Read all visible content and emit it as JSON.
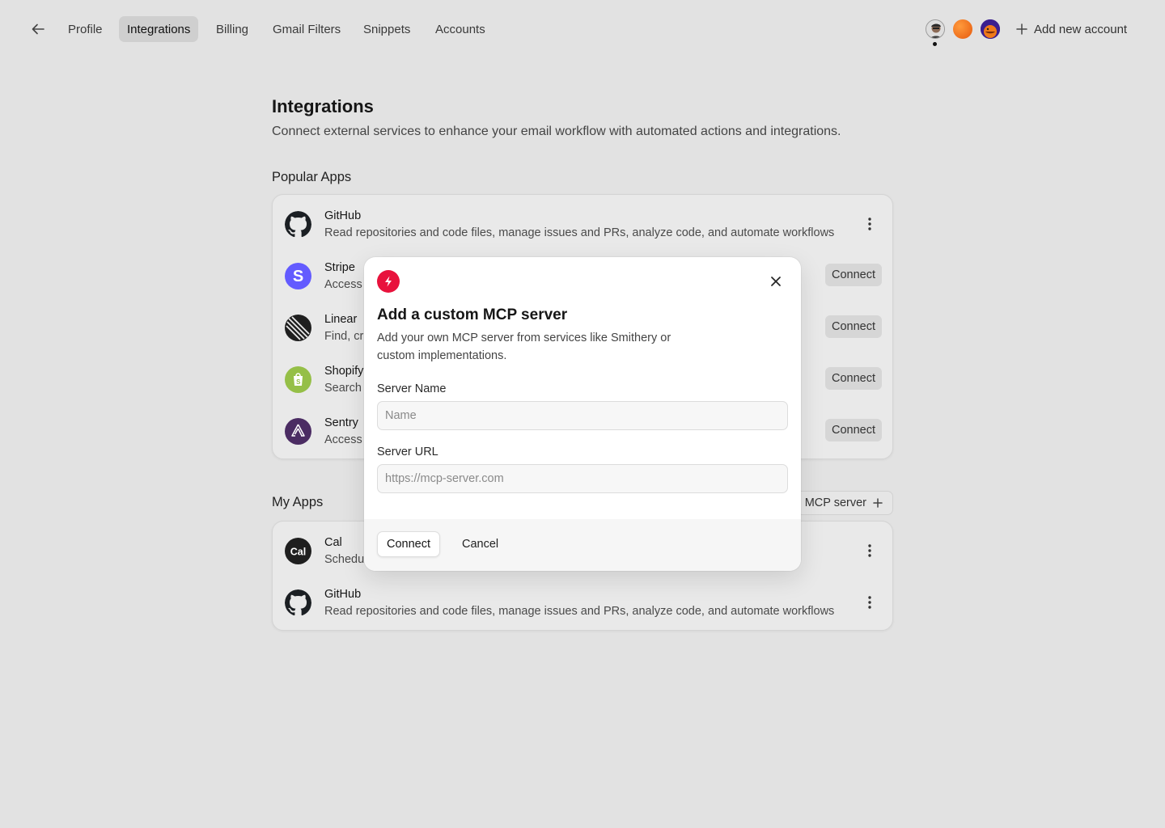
{
  "nav": {
    "back_icon": "arrow-left-icon",
    "tabs": [
      {
        "label": "Profile",
        "active": false
      },
      {
        "label": "Integrations",
        "active": true
      },
      {
        "label": "Billing",
        "active": false
      },
      {
        "label": "Gmail Filters",
        "active": false
      },
      {
        "label": "Snippets",
        "active": false
      },
      {
        "label": "Accounts",
        "active": false
      }
    ],
    "add_account_label": "Add new account"
  },
  "page": {
    "title": "Integrations",
    "subtitle": "Connect external services to enhance your email workflow with automated actions and integrations."
  },
  "popular": {
    "title": "Popular Apps",
    "apps": [
      {
        "name": "GitHub",
        "desc": "Read repositories and code files, manage issues and PRs, analyze code, and automate workflows",
        "action": "menu"
      },
      {
        "name": "Stripe",
        "desc": "Access",
        "action": "Connect"
      },
      {
        "name": "Linear",
        "desc": "Find, cr",
        "action": "Connect"
      },
      {
        "name": "Shopify",
        "desc": "Search",
        "action": "Connect"
      },
      {
        "name": "Sentry",
        "desc": "Access",
        "action": "Connect"
      }
    ]
  },
  "my_apps": {
    "title": "My Apps",
    "add_button_label": "MCP server",
    "apps": [
      {
        "name": "Cal",
        "desc": "Schedu",
        "action": "menu"
      },
      {
        "name": "GitHub",
        "desc": "Read repositories and code files, manage issues and PRs, analyze code, and automate workflows",
        "action": "menu"
      }
    ]
  },
  "modal": {
    "title": "Add a custom MCP server",
    "description": "Add your own MCP server from services like Smithery or custom implementations.",
    "server_name_label": "Server Name",
    "server_name_placeholder": "Name",
    "server_name_value": "",
    "server_url_label": "Server URL",
    "server_url_placeholder": "https://mcp-server.com",
    "server_url_value": "",
    "connect_label": "Connect",
    "cancel_label": "Cancel"
  },
  "colors": {
    "background": "#e2e2e2",
    "modal_accent": "#e8123c",
    "stripe": "#635bff",
    "shopify": "#95bf47",
    "sentry": "#4b2c63"
  }
}
